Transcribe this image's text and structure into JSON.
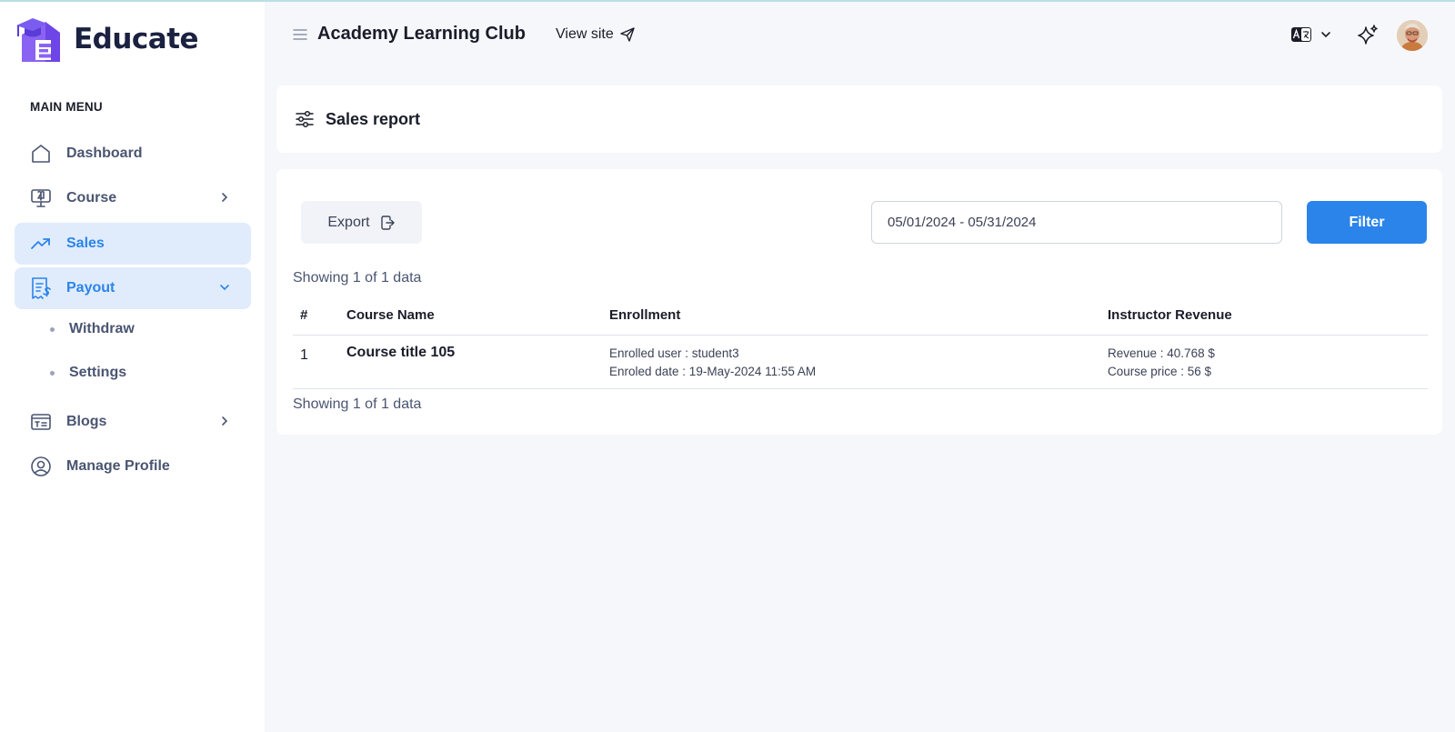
{
  "brand": {
    "name": "Educate"
  },
  "header": {
    "site_title": "Academy Learning Club",
    "view_site_label": "View site",
    "icons": [
      "menu-icon",
      "send-icon",
      "translate-icon",
      "chevron-down-icon",
      "sparkle-icon",
      "avatar"
    ]
  },
  "sidebar": {
    "menu_title": "MAIN MENU",
    "items": [
      {
        "label": "Dashboard",
        "icon": "home-icon",
        "active": false
      },
      {
        "label": "Course",
        "icon": "monitor-icon",
        "active": false,
        "chevron": "right"
      },
      {
        "label": "Sales",
        "icon": "trending-up-icon",
        "active": true
      },
      {
        "label": "Payout",
        "icon": "receipt-dollar-icon",
        "active": true,
        "chevron": "down"
      },
      {
        "label": "Blogs",
        "icon": "article-icon",
        "active": false,
        "chevron": "right"
      },
      {
        "label": "Manage Profile",
        "icon": "user-circle-icon",
        "active": false
      }
    ],
    "payout_sub": [
      {
        "label": "Withdraw"
      },
      {
        "label": "Settings"
      }
    ]
  },
  "page": {
    "title": "Sales report",
    "export_label": "Export",
    "date_range": "05/01/2024 - 05/31/2024",
    "filter_label": "Filter",
    "showing_top": "Showing 1 of 1 data",
    "showing_bottom": "Showing 1 of 1 data"
  },
  "table": {
    "headers": [
      "#",
      "Course Name",
      "Enrollment",
      "Instructor Revenue"
    ],
    "rows": [
      {
        "num": "1",
        "course": "Course title 105",
        "enrolled_user": "Enrolled user : student3",
        "enrolled_date": "Enroled date : 19-May-2024 11:55 AM",
        "revenue": "Revenue : 40.768 $",
        "course_price": "Course price : 56 $"
      }
    ]
  },
  "colors": {
    "accent": "#2b84ea",
    "active_bg": "#e0ecfc",
    "brand_purple": "#7b5cf0",
    "main_bg": "#f6f7fb"
  }
}
